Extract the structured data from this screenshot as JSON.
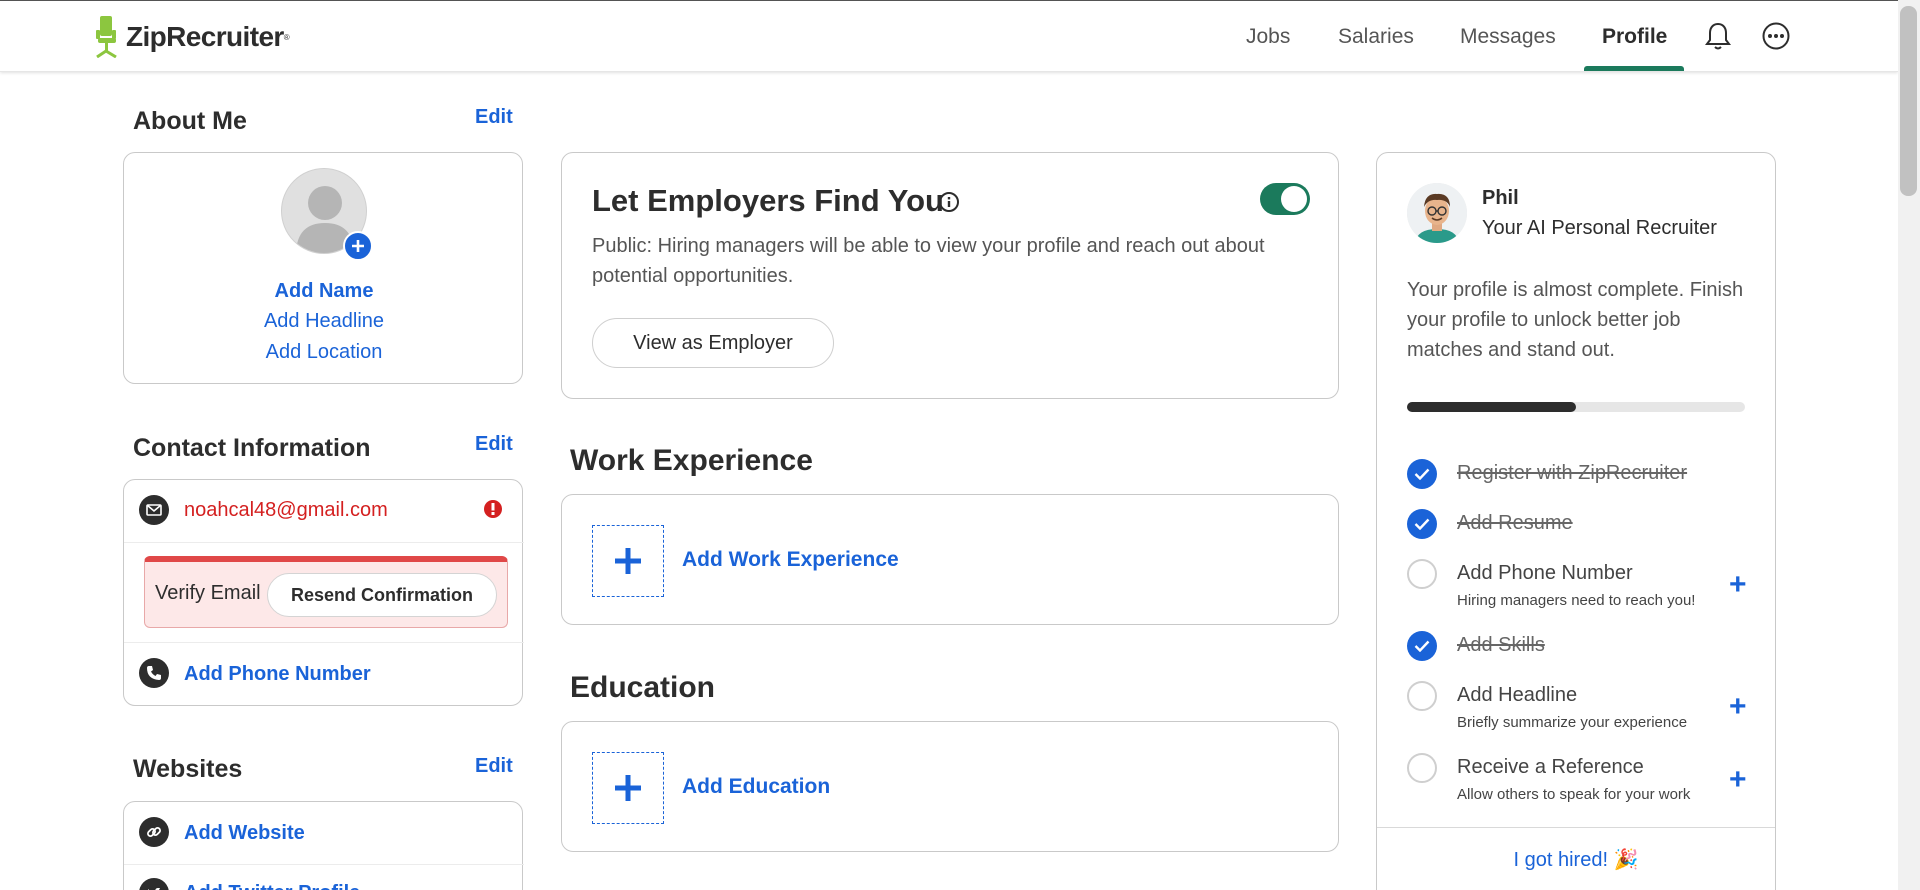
{
  "header": {
    "brand": "ZipRecruiter",
    "nav": [
      "Jobs",
      "Salaries",
      "Messages",
      "Profile"
    ],
    "active_nav": "Profile",
    "accent_color": "#1b7a5c"
  },
  "about_me": {
    "title": "About Me",
    "edit": "Edit",
    "add_name": "Add Name",
    "add_headline": "Add Headline",
    "add_location": "Add Location"
  },
  "contact": {
    "title": "Contact Information",
    "edit": "Edit",
    "email": "noahcal48@gmail.com",
    "verify_label": "Verify Email",
    "resend": "Resend Confirmation",
    "add_phone": "Add Phone Number"
  },
  "websites": {
    "title": "Websites",
    "edit": "Edit",
    "add_website": "Add Website",
    "add_twitter": "Add Twitter Profile"
  },
  "visibility": {
    "title": "Let Employers Find You",
    "description": "Public: Hiring managers will be able to view your profile and reach out about potential opportunities.",
    "view_button": "View as Employer",
    "enabled": true
  },
  "work_experience": {
    "title": "Work Experience",
    "add_label": "Add Work Experience"
  },
  "education": {
    "title": "Education",
    "add_label": "Add Education"
  },
  "recruiter": {
    "name": "Phil",
    "role": "Your AI Personal Recruiter",
    "message": "Your profile is almost complete. Finish your profile to unlock better job matches and stand out.",
    "progress": 0.5,
    "tasks": [
      {
        "title": "Register with ZipRecruiter",
        "done": true
      },
      {
        "title": "Add Resume",
        "done": true
      },
      {
        "title": "Add Phone Number",
        "subtitle": "Hiring managers need to reach you!",
        "done": false
      },
      {
        "title": "Add Skills",
        "done": true
      },
      {
        "title": "Add Headline",
        "subtitle": "Briefly summarize your experience",
        "done": false
      },
      {
        "title": "Receive a Reference",
        "subtitle": "Allow others to speak for your work",
        "done": false
      }
    ],
    "hired_link": "I got hired! 🎉"
  }
}
